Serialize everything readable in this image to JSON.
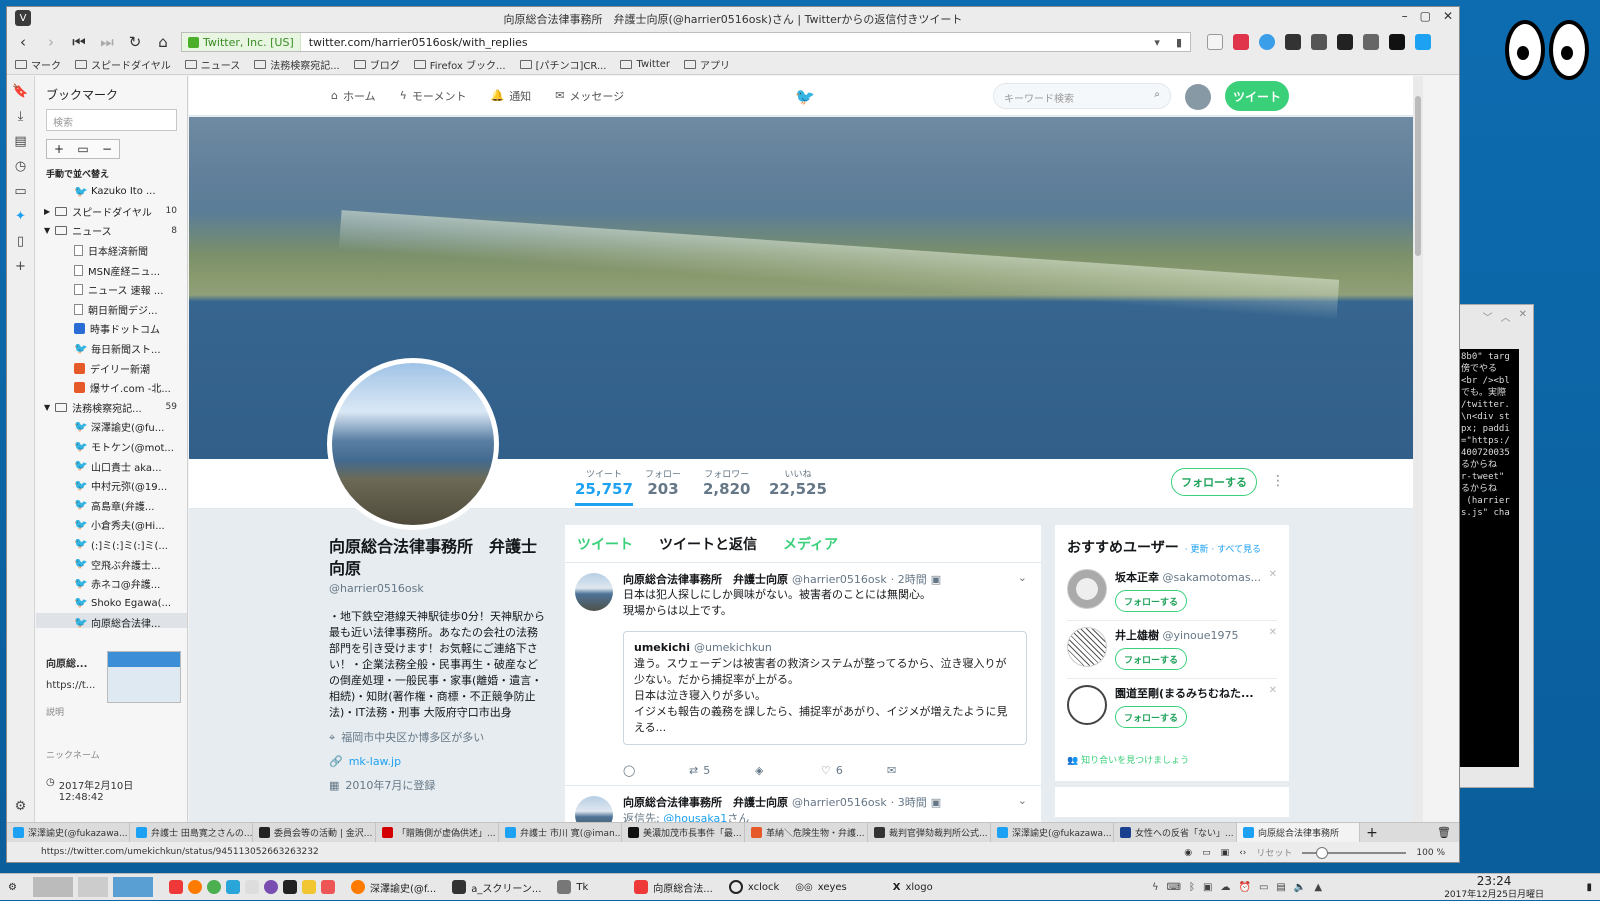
{
  "window": {
    "title": "向原総合法律事務所　弁護士向原(@harrier0516osk)さん | Twitterからの返信付きツイート"
  },
  "address": {
    "security_label": "Twitter, Inc. [US]",
    "url": "twitter.com/harrier0516osk/with_replies"
  },
  "bookmarks_toolbar": [
    "マーク",
    "スピードダイヤル",
    "ニュース",
    "法務検察宛記...",
    "ブログ",
    "Firefox ブック...",
    "[パチンコ]CR...",
    "Twitter",
    "アプリ"
  ],
  "bookmark_panel": {
    "title": "ブックマーク",
    "search_placeholder": "検索",
    "sort_label": "手動で並べ替え",
    "items": [
      {
        "label": "Kazuko Ito ...",
        "icon": "twitter-icon",
        "count": ""
      },
      {
        "label": "スピードダイヤル",
        "icon": "folder-icon",
        "count": "10"
      },
      {
        "label": "ニュース",
        "icon": "folder-icon",
        "count": "8"
      },
      {
        "label": "日本経済新聞",
        "icon": "page-icon",
        "count": ""
      },
      {
        "label": "MSN産経ニュ...",
        "icon": "page-icon",
        "count": ""
      },
      {
        "label": "ニュース 速報 ...",
        "icon": "page-icon",
        "count": ""
      },
      {
        "label": "朝日新聞デジ...",
        "icon": "page-icon",
        "count": ""
      },
      {
        "label": "時事ドットコム",
        "icon": "globe-icon",
        "count": ""
      },
      {
        "label": "毎日新聞スト...",
        "icon": "twitter-icon",
        "count": ""
      },
      {
        "label": "デイリー新潮",
        "icon": "site-icon",
        "count": ""
      },
      {
        "label": "爆サイ.com -北...",
        "icon": "site-icon",
        "count": ""
      },
      {
        "label": "法務検察宛記...",
        "icon": "folder-icon",
        "count": "59"
      },
      {
        "label": "深澤諭史(@fu...",
        "icon": "twitter-icon",
        "count": ""
      },
      {
        "label": "モトケン(@mot...",
        "icon": "twitter-icon",
        "count": ""
      },
      {
        "label": "山口貴士 aka...",
        "icon": "twitter-icon",
        "count": ""
      },
      {
        "label": "中村元弥(@19...",
        "icon": "twitter-icon",
        "count": ""
      },
      {
        "label": "高島章(弁護...",
        "icon": "twitter-icon",
        "count": ""
      },
      {
        "label": "小倉秀夫(@Hi...",
        "icon": "twitter-icon",
        "count": ""
      },
      {
        "label": "(:]ミ(:]ミ(:]ミ(...",
        "icon": "twitter-icon",
        "count": ""
      },
      {
        "label": "空飛ぶ弁護士...",
        "icon": "twitter-icon",
        "count": ""
      },
      {
        "label": "赤ネコ@弁護...",
        "icon": "twitter-icon",
        "count": ""
      },
      {
        "label": "Shoko Egawa(...",
        "icon": "twitter-icon",
        "count": ""
      },
      {
        "label": "向原総合法律...",
        "icon": "twitter-icon",
        "count": ""
      }
    ],
    "detail": {
      "name": "向原総...",
      "url": "https://t...",
      "desc_label": "説明",
      "nick_label": "ニックネーム",
      "date": "2017年2月10日 12:48:42"
    }
  },
  "twitter_nav": {
    "home": "ホーム",
    "moments": "モーメント",
    "notifications": "通知",
    "messages": "メッセージ",
    "search_placeholder": "キーワード検索",
    "tweet_button": "ツイート"
  },
  "profile": {
    "stats": [
      {
        "label": "ツイート",
        "value": "25,757"
      },
      {
        "label": "フォロー",
        "value": "203"
      },
      {
        "label": "フォロワー",
        "value": "2,820"
      },
      {
        "label": "いいね",
        "value": "22,525"
      }
    ],
    "follow_button": "フォローする",
    "name": "向原総合法律事務所　弁護士向原",
    "handle": "@harrier0516osk",
    "bio": "・地下鉄空港線天神駅徒歩0分！天神駅から最も近い法律事務所。あなたの会社の法務部門を引き受けます！お気軽にご連絡下さい！・企業法務全般・民事再生・破産などの倒産処理・一般民事・家事(離婚・遺言・相続)・知財(著作権・商標・不正競争防止法)・IT法務・刑事 大阪府守口市出身",
    "location": "福岡市中央区か博多区が多い",
    "website": "mk-law.jp",
    "joined": "2010年7月に登録"
  },
  "timeline": {
    "tabs": [
      "ツイート",
      "ツイートと返信",
      "メディア"
    ],
    "tweets": [
      {
        "name": "向原総合法律事務所　弁護士向原",
        "handle": "@harrier0516osk",
        "time": "· 2時間",
        "text": "日本は犯人探しにしか興味がない。被害者のことには無関心。\n現場からは以上です。",
        "quote": {
          "name": "umekichi",
          "handle": "@umekichkun",
          "text": "違う。スウェーデンは被害者の救済システムが整ってるから、泣き寝入りが少ない。だから捕捉率が上がる。\n日本は泣き寝入りが多い。\nイジメも報告の義務を課したら、捕捉率があがり、イジメが増えたように見える..."
        },
        "retweets": "5",
        "likes": "6"
      },
      {
        "name": "向原総合法律事務所　弁護士向原",
        "handle": "@harrier0516osk",
        "time": "· 3時間",
        "reply_prefix": "返信先:",
        "reply_to": "@housaka1",
        "reply_suffix": "さん"
      }
    ]
  },
  "suggestions": {
    "title": "おすすめユーザー",
    "links": "· 更新 · すべて見る",
    "users": [
      {
        "name": "坂本正幸",
        "handle": "@sakamotomas...",
        "follow": "フォローする"
      },
      {
        "name": "井上雄樹",
        "handle": "@yinoue1975",
        "follow": "フォローする"
      },
      {
        "name": "園道至剛(まるみちむねた...",
        "handle": "",
        "follow": "フォローする"
      }
    ],
    "find_friends": "知り合いを見つけましょう"
  },
  "tabs": [
    "深澤諭史(@fukazawa...",
    "弁護士 田島寛之さんの...",
    "委員会等の活動 | 金沢...",
    "「贈賄側が虚偽供述」...",
    "弁護士 市川 寛(@iman...",
    "美濃加茂市長事件「最...",
    "革納＼危険生物・弁護...",
    "裁判官弾劾裁判所公式...",
    "深澤諭史(@fukazawa...",
    "女性への反省「ない」...",
    "向原総合法律事務所"
  ],
  "status": {
    "url": "https://twitter.com/umekichkun/status/945113052663263232",
    "reset": "リセット",
    "zoom": "100 %"
  },
  "terminal": {
    "text": "8b0\" targ\n傍でやる\n<br /><bl\nでも。実際\n/twitter.\n\\n<div st\npx; paddi\n=\"https:/\n400720035\nるからね\nr-tweet\"\nるからね\n (harrier\ns.js\" cha"
  },
  "taskbar": {
    "tasks": [
      "深澤諭史(@f...",
      "a_スクリーン...",
      "Tk",
      "向原総合法...",
      "xclock",
      "xeyes",
      "xlogo"
    ],
    "time": "23:24",
    "date": "2017年12月25日月曜日"
  }
}
